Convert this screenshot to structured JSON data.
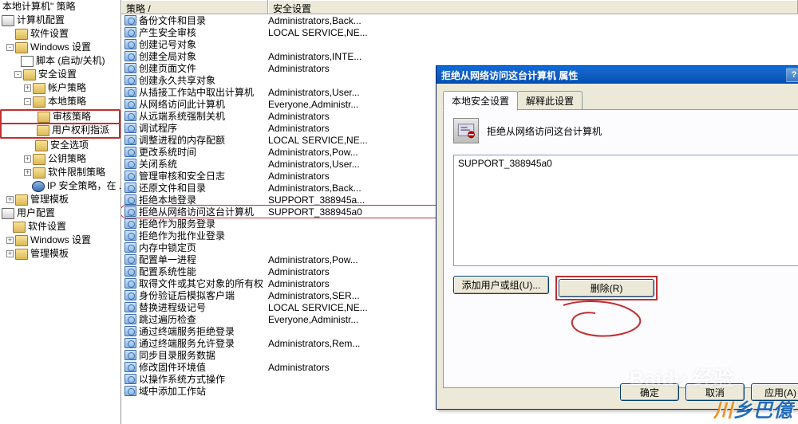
{
  "tree": {
    "root": "本地计算机\" 策略",
    "config": "计算机配置",
    "software": "软件设置",
    "windows": "Windows 设置",
    "scripts": "脚本 (启动/关机)",
    "security": "安全设置",
    "account": "帐户策略",
    "local": "本地策略",
    "audit": "审核策略",
    "userRights": "用户权利指派",
    "secopts": "安全选项",
    "pubkey": "公钥策略",
    "softrestrict": "软件限制策略",
    "ipsec": "IP 安全策略，在 ...",
    "admintpl": "管理模板",
    "userconfig": "用户配置",
    "software2": "软件设置",
    "windows2": "Windows 设置",
    "admintpl2": "管理模板"
  },
  "headers": {
    "policy": "策略  /",
    "security": "安全设置"
  },
  "rows": [
    {
      "p": "备份文件和目录",
      "s": "Administrators,Back..."
    },
    {
      "p": "产生安全审核",
      "s": "LOCAL SERVICE,NE..."
    },
    {
      "p": "创建记号对象",
      "s": ""
    },
    {
      "p": "创建全局对象",
      "s": "Administrators,INTE..."
    },
    {
      "p": "创建页面文件",
      "s": "Administrators"
    },
    {
      "p": "创建永久共享对象",
      "s": ""
    },
    {
      "p": "从插接工作站中取出计算机",
      "s": "Administrators,User..."
    },
    {
      "p": "从网络访问此计算机",
      "s": "Everyone,Administr..."
    },
    {
      "p": "从远端系统强制关机",
      "s": "Administrators"
    },
    {
      "p": "调试程序",
      "s": "Administrators"
    },
    {
      "p": "调整进程的内存配额",
      "s": "LOCAL SERVICE,NE..."
    },
    {
      "p": "更改系统时间",
      "s": "Administrators,Pow..."
    },
    {
      "p": "关闭系统",
      "s": "Administrators,User..."
    },
    {
      "p": "管理审核和安全日志",
      "s": "Administrators"
    },
    {
      "p": "还原文件和目录",
      "s": "Administrators,Back..."
    },
    {
      "p": "拒绝本地登录",
      "s": "SUPPORT_388945a..."
    },
    {
      "p": "拒绝从网络访问这台计算机",
      "s": "SUPPORT_388945a0",
      "mark": true
    },
    {
      "p": "拒绝作为服务登录",
      "s": ""
    },
    {
      "p": "拒绝作为批作业登录",
      "s": ""
    },
    {
      "p": "内存中锁定页",
      "s": ""
    },
    {
      "p": "配置单一进程",
      "s": "Administrators,Pow..."
    },
    {
      "p": "配置系统性能",
      "s": "Administrators"
    },
    {
      "p": "取得文件或其它对象的所有权",
      "s": "Administrators"
    },
    {
      "p": "身份验证后模拟客户端",
      "s": "Administrators,SER..."
    },
    {
      "p": "替换进程级记号",
      "s": "LOCAL SERVICE,NE..."
    },
    {
      "p": "跳过遍历检查",
      "s": "Everyone,Administr..."
    },
    {
      "p": "通过终端服务拒绝登录",
      "s": ""
    },
    {
      "p": "通过终端服务允许登录",
      "s": "Administrators,Rem..."
    },
    {
      "p": "同步目录服务数据",
      "s": ""
    },
    {
      "p": "修改固件环境值",
      "s": "Administrators"
    },
    {
      "p": "以操作系统方式操作",
      "s": ""
    },
    {
      "p": "域中添加工作站",
      "s": ""
    }
  ],
  "dialog": {
    "title": "拒绝从网络访问这台计算机 属性",
    "tab1": "本地安全设置",
    "tab2": "解释此设置",
    "heading": "拒绝从网络访问这台计算机",
    "listitem": "SUPPORT_388945a0",
    "addBtn": "添加用户或组(U)...",
    "delBtn": "删除(R)",
    "ok": "确定",
    "cancel": "取消",
    "apply": "应用(A)"
  },
  "wm": {
    "text1": "乡巴億",
    "baidu": "Baidu 经验"
  }
}
